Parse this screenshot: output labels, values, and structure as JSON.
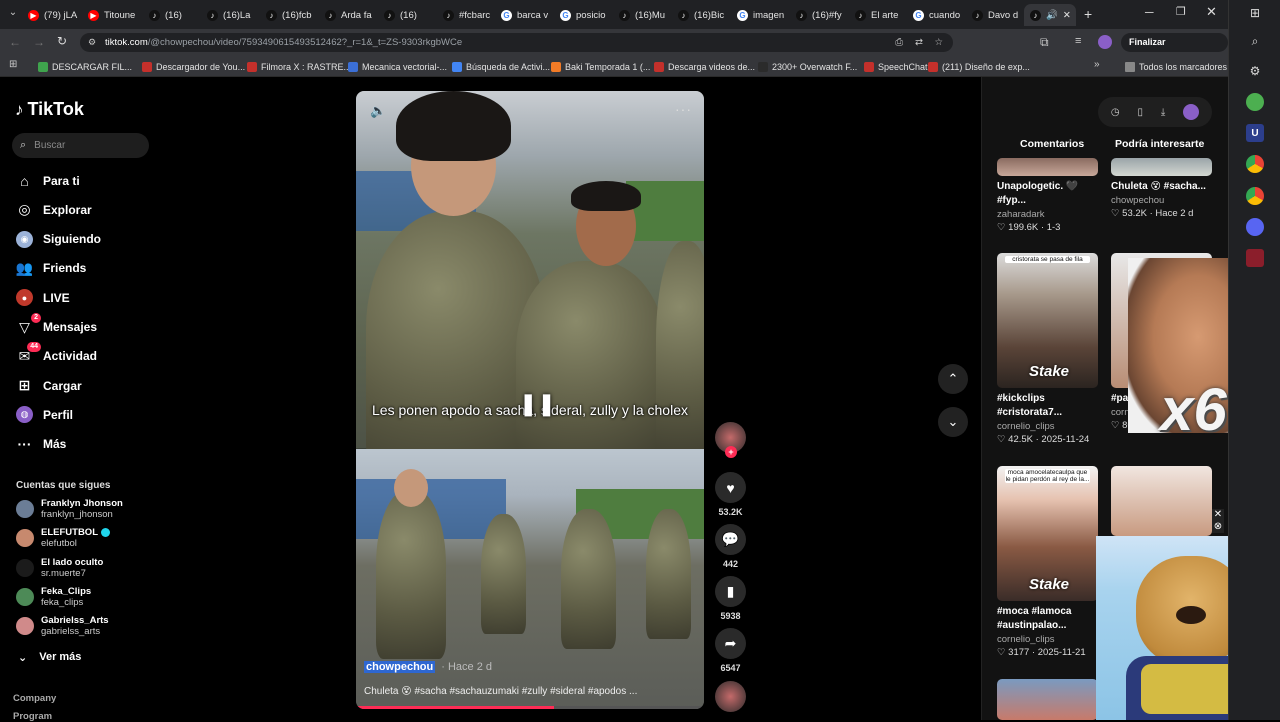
{
  "browser": {
    "tabs": [
      {
        "label": "(79) jLA",
        "icon": "youtube"
      },
      {
        "label": "Titoune",
        "icon": "youtube"
      },
      {
        "label": "(16)",
        "icon": "tiktok"
      },
      {
        "label": "(16)La",
        "icon": "tiktok"
      },
      {
        "label": "(16)fcb",
        "icon": "tiktok"
      },
      {
        "label": "Arda fa",
        "icon": "tiktok"
      },
      {
        "label": "(16)",
        "icon": "tiktok"
      },
      {
        "label": "#fcbarc",
        "icon": "tiktok"
      },
      {
        "label": "barca v",
        "icon": "google"
      },
      {
        "label": "posicio",
        "icon": "google"
      },
      {
        "label": "(16)Mu",
        "icon": "tiktok"
      },
      {
        "label": "(16)Bic",
        "icon": "tiktok"
      },
      {
        "label": "imagen",
        "icon": "google"
      },
      {
        "label": "(16)#fy",
        "icon": "tiktok"
      },
      {
        "label": "El arte",
        "icon": "tiktok"
      },
      {
        "label": "cuando",
        "icon": "google"
      },
      {
        "label": "Davo d",
        "icon": "tiktok"
      }
    ],
    "url_host": "tiktok.com",
    "url_path": "/@chowpechou/video/7593490615493512462?_r=1&_t=ZS-9303rkgbWCe",
    "update_button": "Finalizar actualización",
    "bookmarks": [
      "DESCARGAR FIL...",
      "Descargador de You...",
      "Filmora X : RASTRE...",
      "Mecanica vectorial-...",
      "Búsqueda de Activi...",
      "Baki Temporada 1 (...",
      "Descarga videos de...",
      "2300+ Overwatch F...",
      "SpeechChat",
      "(211) Diseño de exp..."
    ],
    "all_bookmarks": "Todos los marcadores"
  },
  "tiktok": {
    "logo": "TikTok",
    "search_placeholder": "Buscar",
    "nav": [
      {
        "label": "Para ti",
        "icon": "home"
      },
      {
        "label": "Explorar",
        "icon": "compass"
      },
      {
        "label": "Siguiendo",
        "icon": "following"
      },
      {
        "label": "Friends",
        "icon": "friends"
      },
      {
        "label": "LIVE",
        "icon": "live"
      },
      {
        "label": "Mensajes",
        "icon": "messages",
        "badge": "2"
      },
      {
        "label": "Actividad",
        "icon": "activity",
        "badge": "44"
      },
      {
        "label": "Cargar",
        "icon": "upload"
      },
      {
        "label": "Perfil",
        "icon": "profile"
      },
      {
        "label": "Más",
        "icon": "more"
      }
    ],
    "following_header": "Cuentas que sigues",
    "following": [
      {
        "name": "Franklyn Jhonson",
        "user": "franklyn_jhonson",
        "color": "#6b7d96"
      },
      {
        "name": "ELEFUTBOL",
        "user": "elefutbol",
        "color": "#c7896e",
        "verified": true
      },
      {
        "name": "El lado oculto",
        "user": "sr.muerte7",
        "color": "#1b1b1b"
      },
      {
        "name": "Feka_Clips",
        "user": "feka_clips",
        "color": "#4d8a57"
      },
      {
        "name": "Gabrielss_Arts",
        "user": "gabrielss_arts",
        "color": "#d08a8a"
      }
    ],
    "see_more": "Ver más",
    "footer": [
      "Company",
      "Program"
    ]
  },
  "video": {
    "caption": "Les ponen apodo a sacha, sideral, zully y la cholex",
    "author": "chowpechou",
    "posted": "· Hace 2 d",
    "description": "Chuleta 😵 #sacha #sachauzumaki #zully #sideral #apodos ...",
    "progress": 0.57,
    "likes": "53.2K",
    "comments": "442",
    "saves": "5938",
    "shares": "6547"
  },
  "panel": {
    "tabs": [
      "Comentarios",
      "Podría interesarte"
    ],
    "cards": [
      {
        "title": "Unapologetic. 🖤 #fyp...",
        "user": "zaharadark",
        "stats": "♡ 199.6K · 1-3"
      },
      {
        "title": "Chuleta 😵 #sacha...",
        "user": "chowpechou",
        "stats": "♡ 53.2K · Hace 2 d"
      },
      {
        "title": "#kickclips #cristorata7...",
        "user": "cornelio_clips",
        "stats": "♡ 42.5K · 2025-11-24",
        "thumb_text": "cristorata se pasa de fila"
      },
      {
        "title": "#pa... #moca #f...",
        "user": "cornelio_cl...",
        "stats": "♡ 8076 · 2025-11-23"
      },
      {
        "title": "#moca #lamoca #austinpalao...",
        "user": "cornelio_clips",
        "stats": "♡ 3177 · 2025-11-21",
        "thumb_text": "moca amocelatecaulpa que le pidan perdón al rey de la..."
      },
      {
        "title": "",
        "user": "",
        "stats": ""
      }
    ],
    "thumb_brand": "Stake",
    "overlay_text": "x6"
  }
}
